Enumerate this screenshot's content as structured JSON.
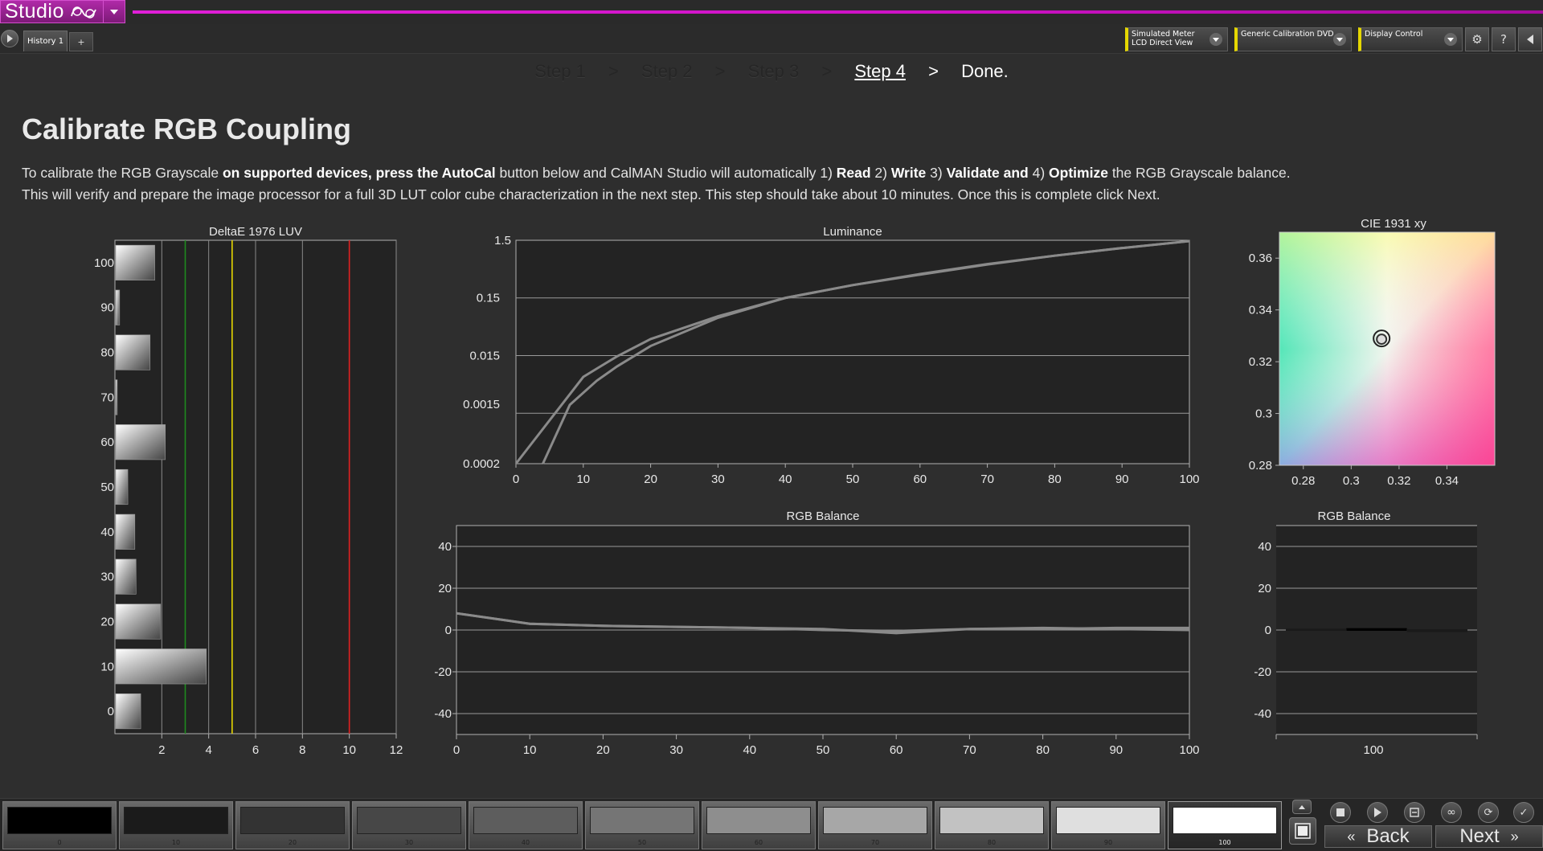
{
  "app": {
    "name": "Studio"
  },
  "tabs": {
    "history": "History 1",
    "add": "+"
  },
  "toolbar": {
    "meter": {
      "line1": "Simulated Meter",
      "line2": "LCD Direct View"
    },
    "source": {
      "line1": "Generic Calibration DVD",
      "line2": ""
    },
    "display": {
      "line1": "Display Control",
      "line2": ""
    },
    "icons": [
      "settings-icon",
      "help-icon",
      "collapse-icon"
    ]
  },
  "steps": [
    "Step 1",
    "Step 2",
    "Step 3",
    "Step 4",
    "Done."
  ],
  "steps_separator": ">",
  "active_step": "Step 4",
  "page": {
    "title": "Calibrate RGB Coupling",
    "description": {
      "p1": "To calibrate the RGB Grayscale ",
      "b1": "on supported devices, press the AutoCal",
      "p2": " button below and CalMAN Studio will automatically  1) ",
      "b2": "Read",
      "p3": "  2) ",
      "b3": "Write",
      "p4": "  3) ",
      "b4": "Validate",
      "p5": "  ",
      "b5": "and",
      "p6": " 4) ",
      "b6": "Optimize",
      "p7": " the RGB Grayscale balance. This will verify and prepare the image processor for a full 3D LUT color cube characterization in the next step. This step should take about 10 minutes. Once this is complete click Next."
    }
  },
  "colors": {
    "accent": "#cc10c4",
    "green_line": "#1e8a1e",
    "yellow_line": "#e5d700",
    "red_line": "#e02020",
    "plot_bg": "#232323",
    "curve": "#8a8a8a"
  },
  "chart_data": [
    {
      "id": "deltae",
      "type": "bar",
      "orientation": "horizontal",
      "title": "DeltaE 1976 LUV",
      "categories": [
        "0",
        "10",
        "20",
        "30",
        "40",
        "50",
        "60",
        "70",
        "80",
        "90",
        "100"
      ],
      "values": [
        1.1,
        3.9,
        1.95,
        0.9,
        0.85,
        0.55,
        2.15,
        0.1,
        1.5,
        0.2,
        1.7
      ],
      "xlim": [
        0,
        12
      ],
      "xticks": [
        "2",
        "4",
        "6",
        "8",
        "10",
        "12"
      ],
      "threshold_lines": [
        {
          "x": 3,
          "color": "#1e8a1e"
        },
        {
          "x": 5,
          "color": "#e5d700"
        },
        {
          "x": 10,
          "color": "#e02020"
        }
      ]
    },
    {
      "id": "luminance",
      "type": "line",
      "title": "Luminance",
      "yscale": "log",
      "ylim": [
        0.0002,
        1.5
      ],
      "yticks": [
        "1.5",
        "0.15",
        "0.015",
        "0.0015",
        "0.0002"
      ],
      "xlim": [
        0,
        100
      ],
      "xticks": [
        "0",
        "10",
        "20",
        "30",
        "40",
        "50",
        "60",
        "70",
        "80",
        "90",
        "100"
      ],
      "series": [
        {
          "x": [
            0,
            10,
            12,
            15,
            20,
            30,
            40,
            50,
            60,
            70,
            80,
            90,
            100
          ],
          "y": [
            0.0002,
            0.0064,
            0.0089,
            0.0145,
            0.029,
            0.072,
            0.15,
            0.25,
            0.39,
            0.58,
            0.81,
            1.1,
            1.45
          ]
        },
        {
          "x": [
            4,
            8,
            12,
            15,
            20,
            30,
            40,
            50,
            60,
            70,
            80,
            90,
            100
          ],
          "y": [
            0.0002,
            0.0021,
            0.0055,
            0.0097,
            0.022,
            0.068,
            0.15,
            0.25,
            0.38,
            0.57,
            0.81,
            1.1,
            1.45
          ]
        }
      ]
    },
    {
      "id": "cie",
      "type": "scatter",
      "title": "CIE 1931 xy",
      "xlim": [
        0.27,
        0.36
      ],
      "ylim": [
        0.28,
        0.37
      ],
      "xticks": [
        "0.28",
        "0.3",
        "0.32",
        "0.34"
      ],
      "yticks": [
        "0.36",
        "0.34",
        "0.32",
        "0.3",
        "0.28"
      ],
      "points": [
        {
          "x": 0.3127,
          "y": 0.329
        }
      ]
    },
    {
      "id": "rgb_balance",
      "type": "line",
      "title": "RGB Balance",
      "ylim": [
        -50,
        50
      ],
      "yticks": [
        "40",
        "20",
        "0",
        "-20",
        "-40"
      ],
      "xlim": [
        0,
        100
      ],
      "xticks": [
        "0",
        "10",
        "20",
        "30",
        "40",
        "50",
        "60",
        "70",
        "80",
        "90",
        "100"
      ],
      "series": [
        {
          "x": [
            0,
            10,
            20,
            30,
            40,
            50,
            60,
            70,
            80,
            90,
            100
          ],
          "y": [
            8,
            3,
            2,
            1.5,
            1,
            0.5,
            -1.5,
            0.5,
            0.5,
            1,
            1
          ]
        },
        {
          "x": [
            0,
            10,
            20,
            30,
            40,
            50,
            60,
            70,
            80,
            90,
            100
          ],
          "y": [
            8,
            3,
            2,
            1.5,
            1,
            0,
            -0.5,
            0.5,
            1,
            0.5,
            0
          ]
        }
      ]
    },
    {
      "id": "rgb_balance_single",
      "type": "bar",
      "title": "RGB Balance",
      "ylim": [
        -50,
        50
      ],
      "yticks": [
        "40",
        "20",
        "0",
        "-20",
        "-40"
      ],
      "categories": [
        "100"
      ],
      "series": [
        {
          "color": "#1a1a1a",
          "values": [
            0.3
          ]
        },
        {
          "color": "#000000",
          "values": [
            0.5
          ]
        },
        {
          "color": "#1a1a1a",
          "values": [
            -0.6
          ]
        }
      ]
    }
  ],
  "bottom": {
    "swatches": [
      {
        "label": "0",
        "color": "#000000"
      },
      {
        "label": "10",
        "color": "#1b1b1b"
      },
      {
        "label": "20",
        "color": "#333333"
      },
      {
        "label": "30",
        "color": "#474747"
      },
      {
        "label": "40",
        "color": "#5d5d5d"
      },
      {
        "label": "50",
        "color": "#757575"
      },
      {
        "label": "60",
        "color": "#8e8e8e"
      },
      {
        "label": "70",
        "color": "#a7a7a7"
      },
      {
        "label": "80",
        "color": "#c2c2c2"
      },
      {
        "label": "90",
        "color": "#dfdfdf"
      },
      {
        "label": "100",
        "color": "#ffffff"
      }
    ],
    "active_swatch": "100",
    "back": "Back",
    "next": "Next",
    "controls": [
      "stop-icon",
      "play-icon",
      "read-icon",
      "loop-icon",
      "refresh-icon",
      "check-icon"
    ]
  }
}
